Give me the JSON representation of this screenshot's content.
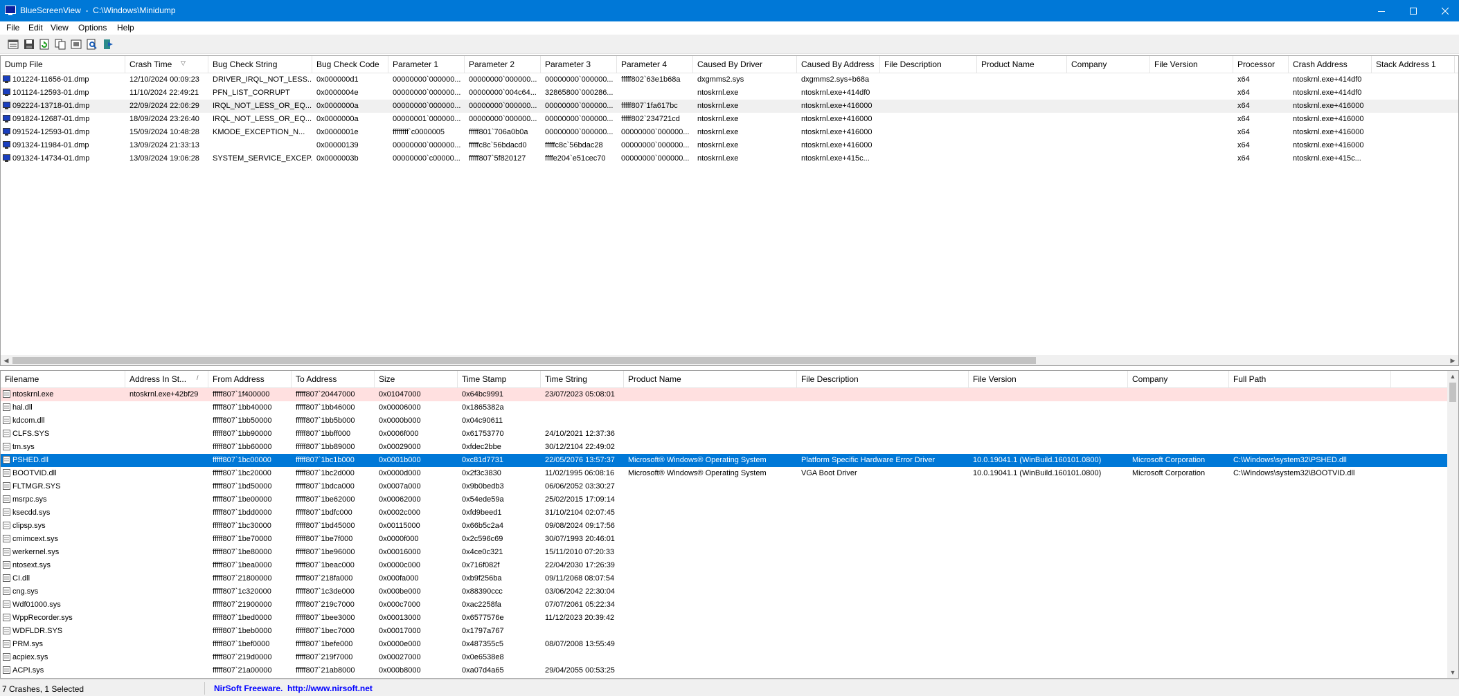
{
  "window": {
    "title": "BlueScreenView  -  C:\\Windows\\Minidump",
    "icon": "bluescreen-app-icon"
  },
  "menu": [
    "File",
    "Edit",
    "View",
    "Options",
    "Help"
  ],
  "toolbar": [
    {
      "name": "properties-icon"
    },
    {
      "name": "save-icon"
    },
    {
      "name": "refresh-icon"
    },
    {
      "name": "copy-icon"
    },
    {
      "name": "advanced-options-icon"
    },
    {
      "name": "find-icon"
    },
    {
      "name": "exit-icon"
    }
  ],
  "crashes": {
    "columns": [
      "Dump File",
      "Crash Time",
      "Bug Check String",
      "Bug Check Code",
      "Parameter 1",
      "Parameter 2",
      "Parameter 3",
      "Parameter 4",
      "Caused By Driver",
      "Caused By Address",
      "File Description",
      "Product Name",
      "Company",
      "File Version",
      "Processor",
      "Crash Address",
      "Stack Address 1"
    ],
    "sort_indicator": "▽",
    "rows": [
      [
        "101224-11656-01.dmp",
        "12/10/2024 00:09:23",
        "DRIVER_IRQL_NOT_LESS...",
        "0x000000d1",
        "00000000`000000...",
        "00000000`000000...",
        "00000000`000000...",
        "fffff802`63e1b68a",
        "dxgmms2.sys",
        "dxgmms2.sys+b68a",
        "",
        "",
        "",
        "",
        "x64",
        "ntoskrnl.exe+414df0",
        ""
      ],
      [
        "101124-12593-01.dmp",
        "11/10/2024 22:49:21",
        "PFN_LIST_CORRUPT",
        "0x0000004e",
        "00000000`000000...",
        "00000000`004c64...",
        "32865800`000286...",
        "",
        "ntoskrnl.exe",
        "ntoskrnl.exe+414df0",
        "",
        "",
        "",
        "",
        "x64",
        "ntoskrnl.exe+414df0",
        ""
      ],
      [
        "092224-13718-01.dmp",
        "22/09/2024 22:06:29",
        "IRQL_NOT_LESS_OR_EQ...",
        "0x0000000a",
        "00000000`000000...",
        "00000000`000000...",
        "00000000`000000...",
        "fffff807`1fa617bc",
        "ntoskrnl.exe",
        "ntoskrnl.exe+416000",
        "",
        "",
        "",
        "",
        "x64",
        "ntoskrnl.exe+416000",
        ""
      ],
      [
        "091824-12687-01.dmp",
        "18/09/2024 23:26:40",
        "IRQL_NOT_LESS_OR_EQ...",
        "0x0000000a",
        "00000001`000000...",
        "00000000`000000...",
        "00000000`000000...",
        "fffff802`234721cd",
        "ntoskrnl.exe",
        "ntoskrnl.exe+416000",
        "",
        "",
        "",
        "",
        "x64",
        "ntoskrnl.exe+416000",
        ""
      ],
      [
        "091524-12593-01.dmp",
        "15/09/2024 10:48:28",
        "KMODE_EXCEPTION_N...",
        "0x0000001e",
        "ffffffff`c0000005",
        "fffff801`706a0b0a",
        "00000000`000000...",
        "00000000`000000...",
        "ntoskrnl.exe",
        "ntoskrnl.exe+416000",
        "",
        "",
        "",
        "",
        "x64",
        "ntoskrnl.exe+416000",
        ""
      ],
      [
        "091324-11984-01.dmp",
        "13/09/2024 21:33:13",
        "",
        "0x00000139",
        "00000000`000000...",
        "fffffc8c`56bdacd0",
        "fffffc8c`56bdac28",
        "00000000`000000...",
        "ntoskrnl.exe",
        "ntoskrnl.exe+416000",
        "",
        "",
        "",
        "",
        "x64",
        "ntoskrnl.exe+416000",
        ""
      ],
      [
        "091324-14734-01.dmp",
        "13/09/2024 19:06:28",
        "SYSTEM_SERVICE_EXCEP...",
        "0x0000003b",
        "00000000`c00000...",
        "fffff807`5f820127",
        "ffffe204`e51cec70",
        "00000000`000000...",
        "ntoskrnl.exe",
        "ntoskrnl.exe+415c...",
        "",
        "",
        "",
        "",
        "x64",
        "ntoskrnl.exe+415c...",
        ""
      ]
    ],
    "highlight_row": 2
  },
  "modules": {
    "columns": [
      "Filename",
      "Address In St...",
      "From Address",
      "To Address",
      "Size",
      "Time Stamp",
      "Time String",
      "Product Name",
      "File Description",
      "File Version",
      "Company",
      "Full Path"
    ],
    "sort_indicator": "/",
    "rows": [
      [
        "ntoskrnl.exe",
        "ntoskrnl.exe+42bf29",
        "fffff807`1f400000",
        "fffff807`20447000",
        "0x01047000",
        "0x64bc9991",
        "23/07/2023 05:08:01",
        "",
        "",
        "",
        "",
        ""
      ],
      [
        "hal.dll",
        "",
        "fffff807`1bb40000",
        "fffff807`1bb46000",
        "0x00006000",
        "0x1865382a",
        "",
        "",
        "",
        "",
        "",
        ""
      ],
      [
        "kdcom.dll",
        "",
        "fffff807`1bb50000",
        "fffff807`1bb5b000",
        "0x0000b000",
        "0x04c90611",
        "",
        "",
        "",
        "",
        "",
        ""
      ],
      [
        "CLFS.SYS",
        "",
        "fffff807`1bb90000",
        "fffff807`1bbff000",
        "0x0006f000",
        "0x61753770",
        "24/10/2021 12:37:36",
        "",
        "",
        "",
        "",
        ""
      ],
      [
        "tm.sys",
        "",
        "fffff807`1bb60000",
        "fffff807`1bb89000",
        "0x00029000",
        "0xfdec2bbe",
        "30/12/2104 22:49:02",
        "",
        "",
        "",
        "",
        ""
      ],
      [
        "PSHED.dll",
        "",
        "fffff807`1bc00000",
        "fffff807`1bc1b000",
        "0x0001b000",
        "0xc81d7731",
        "22/05/2076 13:57:37",
        "Microsoft® Windows® Operating System",
        "Platform Specific Hardware Error Driver",
        "10.0.19041.1 (WinBuild.160101.0800)",
        "Microsoft Corporation",
        "C:\\Windows\\system32\\PSHED.dll"
      ],
      [
        "BOOTVID.dll",
        "",
        "fffff807`1bc20000",
        "fffff807`1bc2d000",
        "0x0000d000",
        "0x2f3c3830",
        "11/02/1995 06:08:16",
        "Microsoft® Windows® Operating System",
        "VGA Boot Driver",
        "10.0.19041.1 (WinBuild.160101.0800)",
        "Microsoft Corporation",
        "C:\\Windows\\system32\\BOOTVID.dll"
      ],
      [
        "FLTMGR.SYS",
        "",
        "fffff807`1bd50000",
        "fffff807`1bdca000",
        "0x0007a000",
        "0x9b0bedb3",
        "06/06/2052 03:30:27",
        "",
        "",
        "",
        "",
        ""
      ],
      [
        "msrpc.sys",
        "",
        "fffff807`1be00000",
        "fffff807`1be62000",
        "0x00062000",
        "0x54ede59a",
        "25/02/2015 17:09:14",
        "",
        "",
        "",
        "",
        ""
      ],
      [
        "ksecdd.sys",
        "",
        "fffff807`1bdd0000",
        "fffff807`1bdfc000",
        "0x0002c000",
        "0xfd9beed1",
        "31/10/2104 02:07:45",
        "",
        "",
        "",
        "",
        ""
      ],
      [
        "clipsp.sys",
        "",
        "fffff807`1bc30000",
        "fffff807`1bd45000",
        "0x00115000",
        "0x66b5c2a4",
        "09/08/2024 09:17:56",
        "",
        "",
        "",
        "",
        ""
      ],
      [
        "cmimcext.sys",
        "",
        "fffff807`1be70000",
        "fffff807`1be7f000",
        "0x0000f000",
        "0x2c596c69",
        "30/07/1993 20:46:01",
        "",
        "",
        "",
        "",
        ""
      ],
      [
        "werkernel.sys",
        "",
        "fffff807`1be80000",
        "fffff807`1be96000",
        "0x00016000",
        "0x4ce0c321",
        "15/11/2010 07:20:33",
        "",
        "",
        "",
        "",
        ""
      ],
      [
        "ntosext.sys",
        "",
        "fffff807`1bea0000",
        "fffff807`1beac000",
        "0x0000c000",
        "0x716f082f",
        "22/04/2030 17:26:39",
        "",
        "",
        "",
        "",
        ""
      ],
      [
        "CI.dll",
        "",
        "fffff807`21800000",
        "fffff807`218fa000",
        "0x000fa000",
        "0xb9f256ba",
        "09/11/2068 08:07:54",
        "",
        "",
        "",
        "",
        ""
      ],
      [
        "cng.sys",
        "",
        "fffff807`1c320000",
        "fffff807`1c3de000",
        "0x000be000",
        "0x88390ccc",
        "03/06/2042 22:30:04",
        "",
        "",
        "",
        "",
        ""
      ],
      [
        "Wdf01000.sys",
        "",
        "fffff807`21900000",
        "fffff807`219c7000",
        "0x000c7000",
        "0xac2258fa",
        "07/07/2061 05:22:34",
        "",
        "",
        "",
        "",
        ""
      ],
      [
        "WppRecorder.sys",
        "",
        "fffff807`1bed0000",
        "fffff807`1bee3000",
        "0x00013000",
        "0x6577576e",
        "11/12/2023 20:39:42",
        "",
        "",
        "",
        "",
        ""
      ],
      [
        "WDFLDR.SYS",
        "",
        "fffff807`1beb0000",
        "fffff807`1bec7000",
        "0x00017000",
        "0x1797a767",
        "",
        "",
        "",
        "",
        "",
        ""
      ],
      [
        "PRM.sys",
        "",
        "fffff807`1bef0000",
        "fffff807`1befe000",
        "0x0000e000",
        "0x487355c5",
        "08/07/2008 13:55:49",
        "",
        "",
        "",
        "",
        ""
      ],
      [
        "acpiex.sys",
        "",
        "fffff807`219d0000",
        "fffff807`219f7000",
        "0x00027000",
        "0x0e6538e8",
        "",
        "",
        "",
        "",
        "",
        ""
      ],
      [
        "ACPI.sys",
        "",
        "fffff807`21a00000",
        "fffff807`21ab8000",
        "0x000b8000",
        "0xa07d4a65",
        "29/04/2055 00:53:25",
        "",
        "",
        "",
        "",
        ""
      ]
    ],
    "pink_row": 0,
    "selected_row": 5
  },
  "status": {
    "left": "7 Crashes, 1 Selected",
    "link": "NirSoft Freeware.  http://www.nirsoft.net"
  },
  "colors": {
    "titlebar": "#0078d7",
    "selection": "#0078d7",
    "pink_row": "#ffe0e0",
    "link": "#0000ff"
  }
}
